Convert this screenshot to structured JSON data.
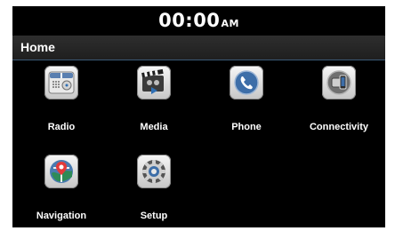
{
  "status": {
    "time": "00:00",
    "ampm": "AM"
  },
  "header": {
    "title": "Home"
  },
  "apps": [
    {
      "label": "Radio",
      "icon": "radio-icon"
    },
    {
      "label": "Media",
      "icon": "media-icon"
    },
    {
      "label": "Phone",
      "icon": "phone-icon"
    },
    {
      "label": "Connectivity",
      "icon": "connectivity-icon"
    },
    {
      "label": "Navigation",
      "icon": "navigation-icon"
    },
    {
      "label": "Setup",
      "icon": "setup-icon"
    }
  ],
  "colors": {
    "background": "#000000",
    "header": "#2a2a2a",
    "accent_blue": "#2f6fb4"
  }
}
